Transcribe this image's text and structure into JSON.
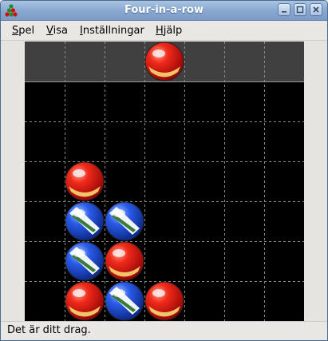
{
  "window": {
    "title": "Four-in-a-row"
  },
  "menu": [
    {
      "mnemonic": "S",
      "rest": "pel"
    },
    {
      "mnemonic": "V",
      "rest": "isa"
    },
    {
      "mnemonic": "I",
      "rest": "nställningar"
    },
    {
      "mnemonic": "H",
      "rest": "jälp"
    }
  ],
  "status": {
    "text": "Det är ditt drag."
  },
  "colors": {
    "red_piece": "#e41212",
    "blue_piece": "#1f4fd8",
    "board": "#000000",
    "drop_row": "#404040",
    "grid_line": "#8a8a8a"
  },
  "game": {
    "columns": 7,
    "rows": 6,
    "drop_row_piece": {
      "column": 4,
      "color": "red"
    },
    "pieces": [
      {
        "column": 2,
        "row": 3,
        "color": "red"
      },
      {
        "column": 2,
        "row": 4,
        "color": "blue"
      },
      {
        "column": 3,
        "row": 4,
        "color": "blue"
      },
      {
        "column": 2,
        "row": 5,
        "color": "blue"
      },
      {
        "column": 3,
        "row": 5,
        "color": "red"
      },
      {
        "column": 2,
        "row": 6,
        "color": "red"
      },
      {
        "column": 3,
        "row": 6,
        "color": "blue"
      },
      {
        "column": 4,
        "row": 6,
        "color": "red"
      }
    ]
  }
}
